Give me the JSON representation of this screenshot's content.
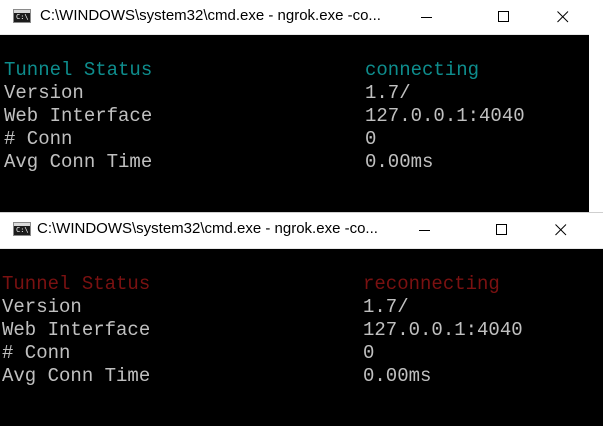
{
  "windows": [
    {
      "title": "C:\\WINDOWS\\system32\\cmd.exe - ngrok.exe  -co...",
      "icon": "cmd-icon",
      "icon_text": "C:\\.",
      "rows": [
        {
          "label": "Tunnel Status",
          "value": "connecting"
        },
        {
          "label": "Version",
          "value": "1.7/"
        },
        {
          "label": "Web Interface",
          "value": "127.0.0.1:4040"
        },
        {
          "label": "# Conn",
          "value": "0"
        },
        {
          "label": "Avg Conn Time",
          "value": "0.00ms"
        }
      ],
      "status_color": "#0e8d8d"
    },
    {
      "title": "C:\\WINDOWS\\system32\\cmd.exe - ngrok.exe  -co...",
      "icon": "cmd-icon",
      "icon_text": "C:\\.",
      "rows": [
        {
          "label": "Tunnel Status",
          "value": "reconnecting"
        },
        {
          "label": "Version",
          "value": "1.7/"
        },
        {
          "label": "Web Interface",
          "value": "127.0.0.1:4040"
        },
        {
          "label": "# Conn",
          "value": "0"
        },
        {
          "label": "Avg Conn Time",
          "value": "0.00ms"
        }
      ],
      "status_color": "#7a1111"
    }
  ],
  "colors": {
    "terminal_bg": "#000000",
    "terminal_text": "#c0c0c0",
    "titlebar_bg": "#ffffff"
  }
}
